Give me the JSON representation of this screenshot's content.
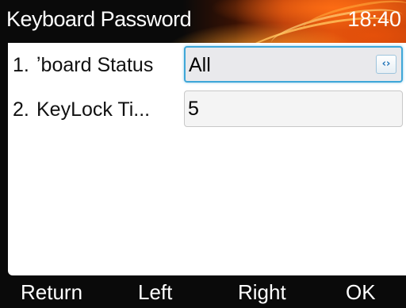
{
  "header": {
    "title": "Keyboard Password",
    "time": "18:40"
  },
  "settings": [
    {
      "number": "1.",
      "label": "ʼboard Status",
      "value": "All",
      "control": "select",
      "focused": true
    },
    {
      "number": "2.",
      "label": "KeyLock Ti...",
      "value": "5",
      "control": "input",
      "focused": false
    }
  ],
  "softkeys": {
    "return": "Return",
    "left": "Left",
    "right": "Right",
    "ok": "OK"
  },
  "icons": {
    "select_arrows": "left-right-arrows-icon"
  },
  "colors": {
    "focus_border": "#3fa7d8",
    "title_accent": "#e0560f",
    "background_dark": "#0a0a0a"
  }
}
